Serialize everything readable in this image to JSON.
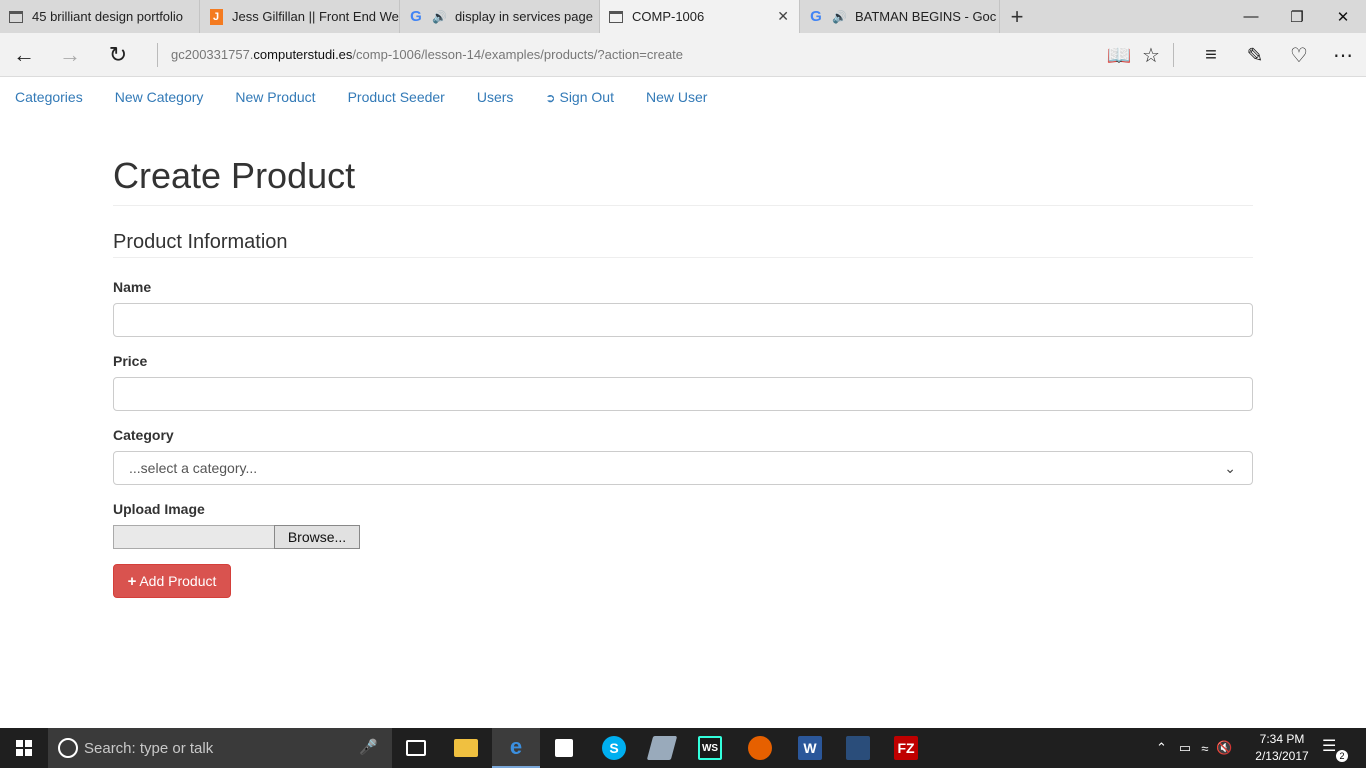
{
  "browser": {
    "tabs": [
      {
        "title": "45 brilliant design portfolio",
        "icon": "page-icon",
        "active": false,
        "audio": false
      },
      {
        "title": "Jess Gilfillan || Front End We",
        "icon": "j-favicon",
        "active": false,
        "audio": false
      },
      {
        "title": "display in services page",
        "icon": "google-icon",
        "active": false,
        "audio": true
      },
      {
        "title": "COMP-1006",
        "icon": "page-icon",
        "active": true,
        "audio": false
      },
      {
        "title": "BATMAN BEGINS - Goc",
        "icon": "google-icon",
        "active": false,
        "audio": true
      }
    ],
    "url_prefix": "gc200331757.",
    "url_domain": "computerstudi.es",
    "url_path": "/comp-1006/lesson-14/examples/products/?action=create"
  },
  "nav": {
    "items": [
      {
        "label": "Categories"
      },
      {
        "label": "New Category"
      },
      {
        "label": "New Product"
      },
      {
        "label": "Product Seeder"
      },
      {
        "label": "Users"
      },
      {
        "label": "Sign Out"
      },
      {
        "label": "New User"
      }
    ]
  },
  "form": {
    "page_title": "Create Product",
    "section_title": "Product Information",
    "name_label": "Name",
    "name_value": "",
    "price_label": "Price",
    "price_value": "",
    "category_label": "Category",
    "category_selected": "...select a category...",
    "image_label": "Upload Image",
    "browse_label": "Browse...",
    "submit_label": "Add Product"
  },
  "taskbar": {
    "search_placeholder": "Search: type or talk",
    "time": "7:34 PM",
    "date": "2/13/2017",
    "notifications": "2"
  },
  "colors": {
    "link": "#337ab7",
    "danger": "#d9534f",
    "taskbar": "#1f1f1f"
  }
}
